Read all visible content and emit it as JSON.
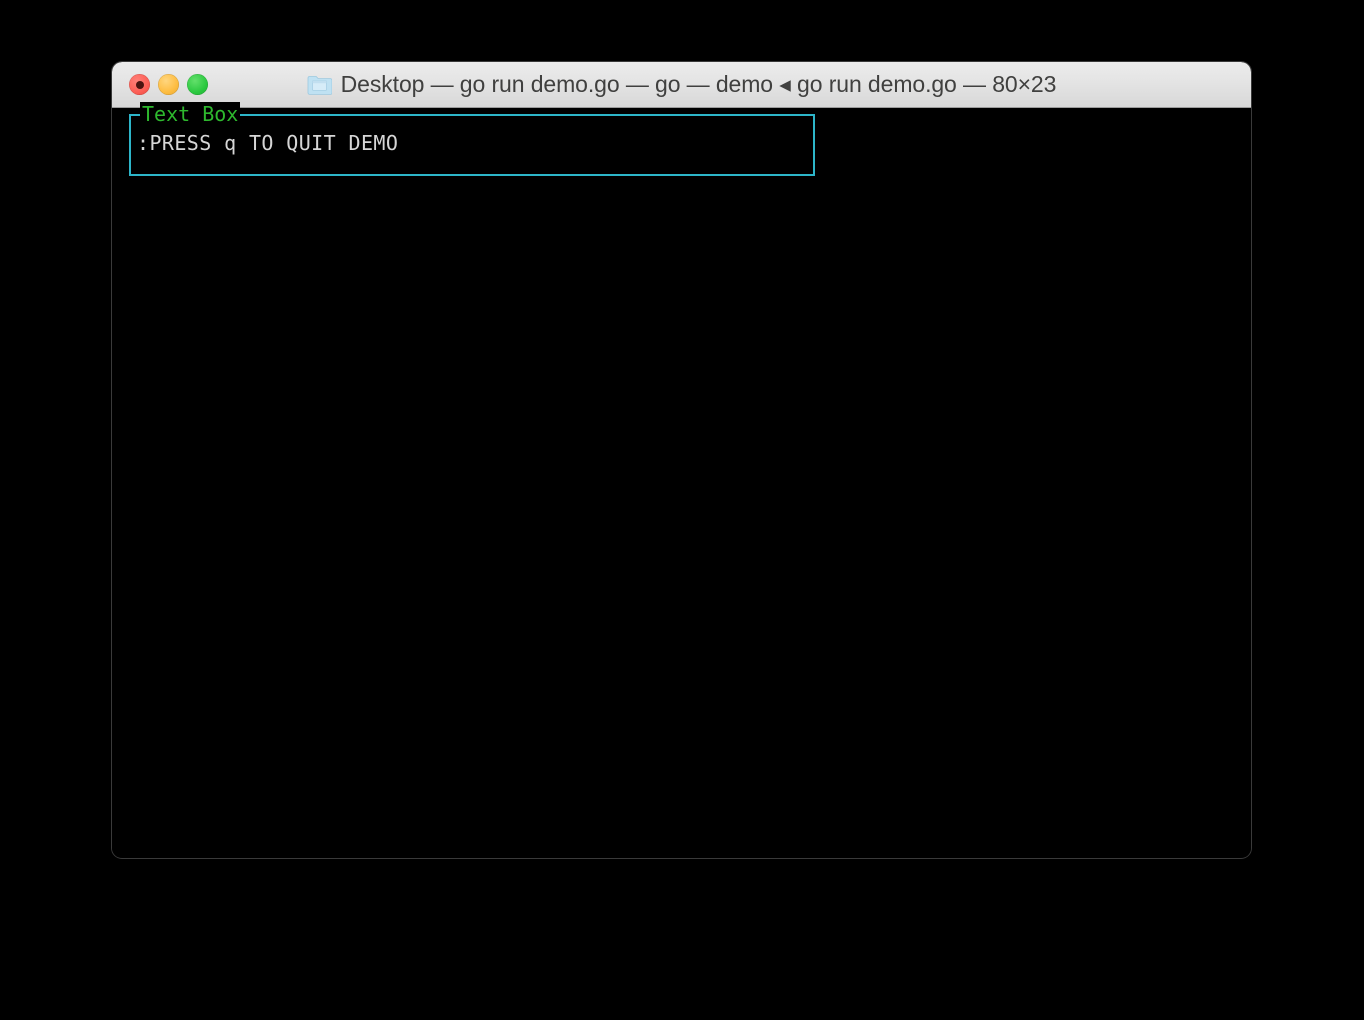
{
  "desktop": {
    "background_color": "#000000"
  },
  "window": {
    "title": "Desktop — go run demo.go — go — demo ◂ go run demo.go — 80×23",
    "folder_icon": "folder-icon",
    "titlebar_color": "#e4e4e4",
    "body_color": "#000000",
    "controls": {
      "close_label": "Close",
      "minimize_label": "Minimize",
      "maximize_label": "Maximize",
      "close_color": "#fc5f56",
      "minimize_color": "#fdbc40",
      "maximize_color": "#2bc840"
    },
    "terminal": {
      "columns": 80,
      "rows": 23
    }
  },
  "text_box": {
    "label": "Text Box",
    "content": ":PRESS q TO QUIT DEMO",
    "border_color": "#2db5c9",
    "label_color": "#2eb82e",
    "content_color": "#d6d6d6"
  }
}
